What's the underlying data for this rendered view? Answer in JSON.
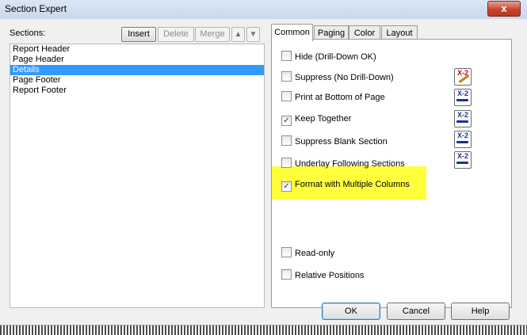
{
  "window": {
    "title": "Section Expert",
    "close_label": "x"
  },
  "sections": {
    "label": "Sections:",
    "toolbar": {
      "insert": "Insert",
      "delete": "Delete",
      "merge": "Merge",
      "up": "▲",
      "down": "▼"
    },
    "items": [
      "Report Header",
      "Page Header",
      "Details",
      "Page Footer",
      "Report Footer"
    ],
    "selected": "Details"
  },
  "tabs": [
    "Common",
    "Paging",
    "Color",
    "Layout"
  ],
  "active_tab": "Common",
  "options": [
    {
      "label": "Hide (Drill-Down OK)",
      "checked": false
    },
    {
      "label": "Suppress (No Drill-Down)",
      "checked": false
    },
    {
      "label": "Print at Bottom of Page",
      "checked": false
    },
    {
      "label": "Keep Together",
      "checked": true
    },
    {
      "label": "Suppress Blank Section",
      "checked": false
    },
    {
      "label": "Underlay Following Sections",
      "checked": false
    },
    {
      "label": "Format with Multiple Columns",
      "checked": true
    },
    {
      "label": "Read-only",
      "checked": false
    },
    {
      "label": "Relative Positions",
      "checked": false
    }
  ],
  "formula_icon_text": "X-2",
  "highlight_color": "#ffff3b",
  "buttons": {
    "ok": "OK",
    "cancel": "Cancel",
    "help": "Help"
  }
}
